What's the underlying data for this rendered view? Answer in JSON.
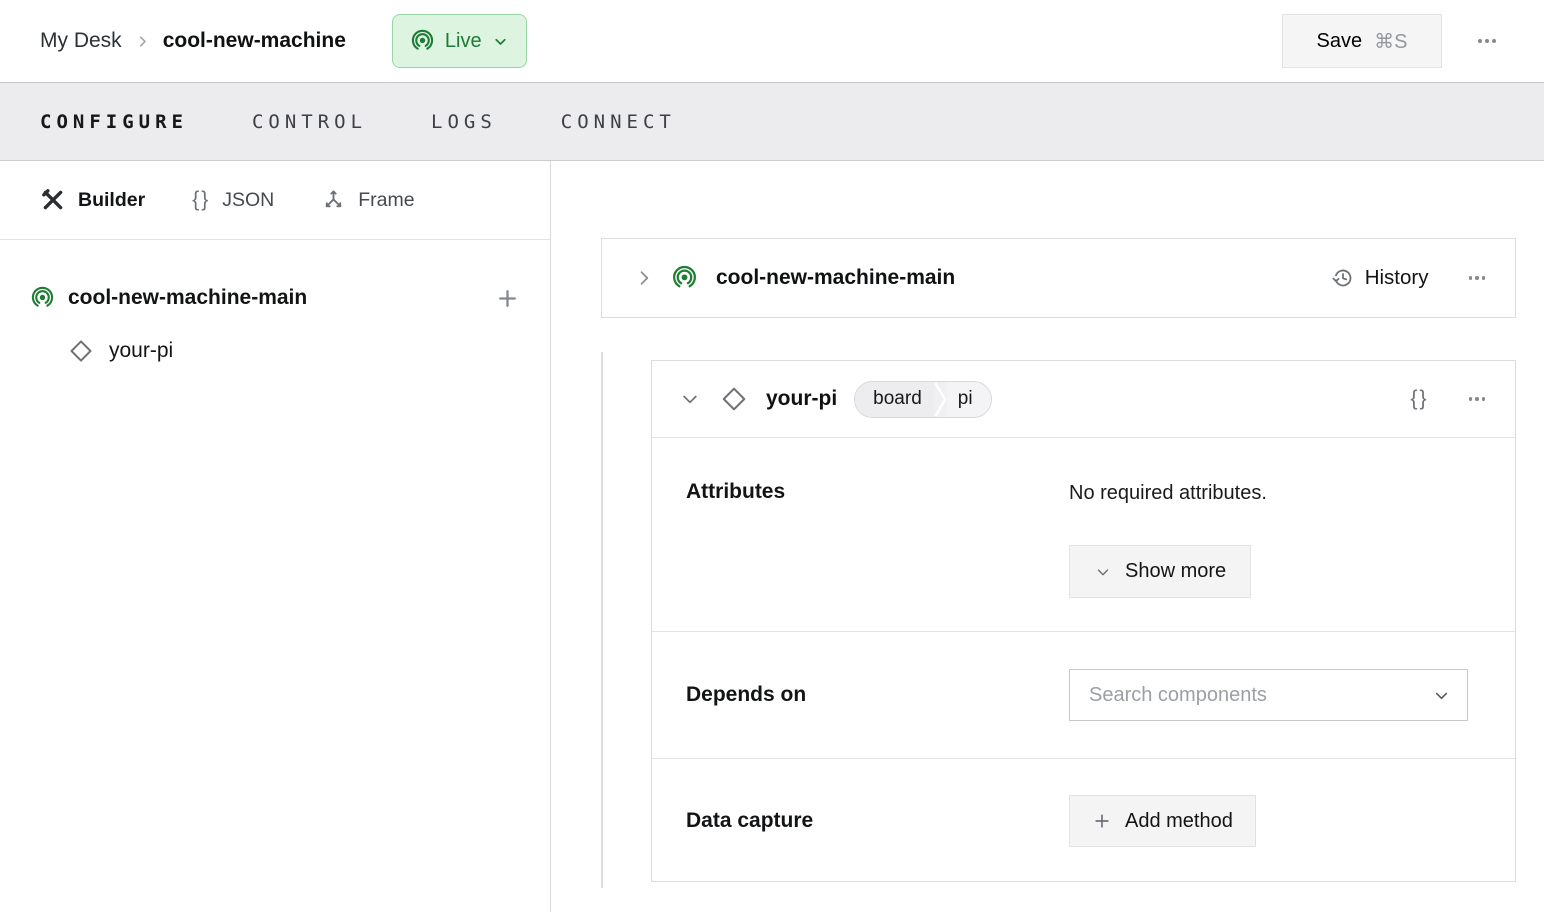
{
  "topbar": {
    "breadcrumb": [
      "My Desk",
      "cool-new-machine"
    ],
    "live_badge": "Live",
    "save_label": "Save",
    "save_shortcut": "⌘S"
  },
  "tabs": {
    "configure": "CONFIGURE",
    "control": "CONTROL",
    "logs": "LOGS",
    "connect": "CONNECT"
  },
  "sidebar": {
    "modes": {
      "builder": "Builder",
      "json": "JSON",
      "frame": "Frame"
    },
    "tree": {
      "part": "cool-new-machine-main",
      "component": "your-pi"
    }
  },
  "main": {
    "part_card": {
      "title": "cool-new-machine-main",
      "history": "History"
    },
    "component_card": {
      "title": "your-pi",
      "badge_type": "board",
      "badge_model": "pi",
      "attributes": {
        "label": "Attributes",
        "empty": "No required attributes.",
        "show_more": "Show more"
      },
      "depends_on": {
        "label": "Depends on",
        "placeholder": "Search components"
      },
      "data_capture": {
        "label": "Data capture",
        "add_method": "Add method"
      }
    }
  },
  "icons": {
    "braces": "{}"
  },
  "colors": {
    "accent_green": "#1e7a34",
    "live_badge_bg": "#dcf4e0",
    "live_badge_border": "#99d6a6",
    "tabstrip_bg": "#ececef",
    "card_border": "#dcdcde",
    "button_bg": "#f4f4f5"
  }
}
